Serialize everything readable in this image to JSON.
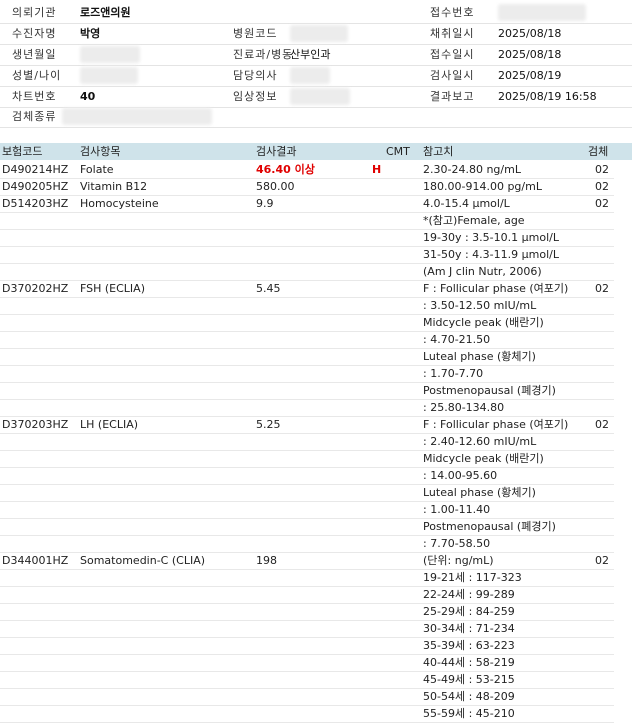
{
  "header": [
    [
      {
        "label": "의뢰기관",
        "value": "로즈앤의원",
        "bold": true
      },
      {
        "label": "",
        "value": ""
      },
      {
        "label": "접수번호",
        "value": ""
      }
    ],
    [
      {
        "label": "수진자명",
        "value": "박영",
        "bold": true
      },
      {
        "label": "병원코드",
        "value": ""
      },
      {
        "label": "채취일시",
        "value": "2025/08/18"
      }
    ],
    [
      {
        "label": "생년월일",
        "value": ""
      },
      {
        "label": "진료과/병동",
        "value": "산부인과"
      },
      {
        "label": "접수일시",
        "value": "2025/08/18"
      }
    ],
    [
      {
        "label": "성별/나이",
        "value": ""
      },
      {
        "label": "담당의사",
        "value": ""
      },
      {
        "label": "검사일시",
        "value": "2025/08/19"
      }
    ],
    [
      {
        "label": "차트번호",
        "value": "40",
        "bold": true
      },
      {
        "label": "임상정보",
        "value": ""
      },
      {
        "label": "결과보고",
        "value": "2025/08/19 16:58"
      }
    ],
    [
      {
        "label": "검체종류",
        "value": ""
      },
      {
        "label": "",
        "value": ""
      },
      {
        "label": "",
        "value": ""
      }
    ]
  ],
  "table": {
    "columns": {
      "code": "보험코드",
      "item": "검사항목",
      "result": "검사결과",
      "cmt": "CMT",
      "ref": "참고치",
      "spec": "검체"
    },
    "rows": [
      {
        "code": "D490214HZ",
        "item": "Folate",
        "result": "46.40 이상",
        "flag": "H",
        "ref": "2.30-24.80 ng/mL",
        "spec": "02"
      },
      {
        "code": "D490205HZ",
        "item": "Vitamin B12",
        "result": "580.00",
        "flag": "",
        "ref": "180.00-914.00 pg/mL",
        "spec": "02"
      },
      {
        "code": "D514203HZ",
        "item": "Homocysteine",
        "result": "9.9",
        "flag": "",
        "ref": "4.0-15.4 μmol/L",
        "spec": "02"
      },
      {
        "code": "",
        "item": "",
        "result": "",
        "flag": "",
        "ref": "*(참고)Female, age",
        "spec": ""
      },
      {
        "code": "",
        "item": "",
        "result": "",
        "flag": "",
        "ref": "19-30y : 3.5-10.1 μmol/L",
        "spec": ""
      },
      {
        "code": "",
        "item": "",
        "result": "",
        "flag": "",
        "ref": "31-50y : 4.3-11.9 μmol/L",
        "spec": ""
      },
      {
        "code": "",
        "item": "",
        "result": "",
        "flag": "",
        "ref": "(Am J clin Nutr, 2006)",
        "spec": ""
      },
      {
        "code": "D370202HZ",
        "item": "FSH (ECLIA)",
        "result": "5.45",
        "flag": "",
        "ref": "F : Follicular phase (여포기)",
        "spec": "02"
      },
      {
        "code": "",
        "item": "",
        "result": "",
        "flag": "",
        "ref": ": 3.50-12.50 mIU/mL",
        "spec": ""
      },
      {
        "code": "",
        "item": "",
        "result": "",
        "flag": "",
        "ref": "Midcycle peak (배란기)",
        "spec": ""
      },
      {
        "code": "",
        "item": "",
        "result": "",
        "flag": "",
        "ref": ": 4.70-21.50",
        "spec": ""
      },
      {
        "code": "",
        "item": "",
        "result": "",
        "flag": "",
        "ref": "Luteal phase (황체기)",
        "spec": ""
      },
      {
        "code": "",
        "item": "",
        "result": "",
        "flag": "",
        "ref": ": 1.70-7.70",
        "spec": ""
      },
      {
        "code": "",
        "item": "",
        "result": "",
        "flag": "",
        "ref": "Postmenopausal (폐경기)",
        "spec": ""
      },
      {
        "code": "",
        "item": "",
        "result": "",
        "flag": "",
        "ref": ": 25.80-134.80",
        "spec": ""
      },
      {
        "code": "D370203HZ",
        "item": "LH (ECLIA)",
        "result": "5.25",
        "flag": "",
        "ref": "F : Follicular phase (여포기)",
        "spec": "02"
      },
      {
        "code": "",
        "item": "",
        "result": "",
        "flag": "",
        "ref": ": 2.40-12.60 mIU/mL",
        "spec": ""
      },
      {
        "code": "",
        "item": "",
        "result": "",
        "flag": "",
        "ref": "Midcycle peak (배란기)",
        "spec": ""
      },
      {
        "code": "",
        "item": "",
        "result": "",
        "flag": "",
        "ref": ": 14.00-95.60",
        "spec": ""
      },
      {
        "code": "",
        "item": "",
        "result": "",
        "flag": "",
        "ref": "Luteal phase (황체기)",
        "spec": ""
      },
      {
        "code": "",
        "item": "",
        "result": "",
        "flag": "",
        "ref": ": 1.00-11.40",
        "spec": ""
      },
      {
        "code": "",
        "item": "",
        "result": "",
        "flag": "",
        "ref": "Postmenopausal (폐경기)",
        "spec": ""
      },
      {
        "code": "",
        "item": "",
        "result": "",
        "flag": "",
        "ref": ": 7.70-58.50",
        "spec": ""
      },
      {
        "code": "D344001HZ",
        "item": "Somatomedin-C (CLIA)",
        "result": "198",
        "flag": "",
        "ref": "(단위: ng/mL)",
        "spec": "02"
      },
      {
        "code": "",
        "item": "",
        "result": "",
        "flag": "",
        "ref": "19-21세 : 117-323",
        "spec": ""
      },
      {
        "code": "",
        "item": "",
        "result": "",
        "flag": "",
        "ref": "22-24세 : 99-289",
        "spec": ""
      },
      {
        "code": "",
        "item": "",
        "result": "",
        "flag": "",
        "ref": "25-29세 : 84-259",
        "spec": ""
      },
      {
        "code": "",
        "item": "",
        "result": "",
        "flag": "",
        "ref": "30-34세 : 71-234",
        "spec": ""
      },
      {
        "code": "",
        "item": "",
        "result": "",
        "flag": "",
        "ref": "35-39세 : 63-223",
        "spec": ""
      },
      {
        "code": "",
        "item": "",
        "result": "",
        "flag": "",
        "ref": "40-44세 : 58-219",
        "spec": ""
      },
      {
        "code": "",
        "item": "",
        "result": "",
        "flag": "",
        "ref": "45-49세 : 53-215",
        "spec": ""
      },
      {
        "code": "",
        "item": "",
        "result": "",
        "flag": "",
        "ref": "50-54세 : 48-209",
        "spec": ""
      },
      {
        "code": "",
        "item": "",
        "result": "",
        "flag": "",
        "ref": "55-59세 : 45-210",
        "spec": ""
      }
    ]
  }
}
